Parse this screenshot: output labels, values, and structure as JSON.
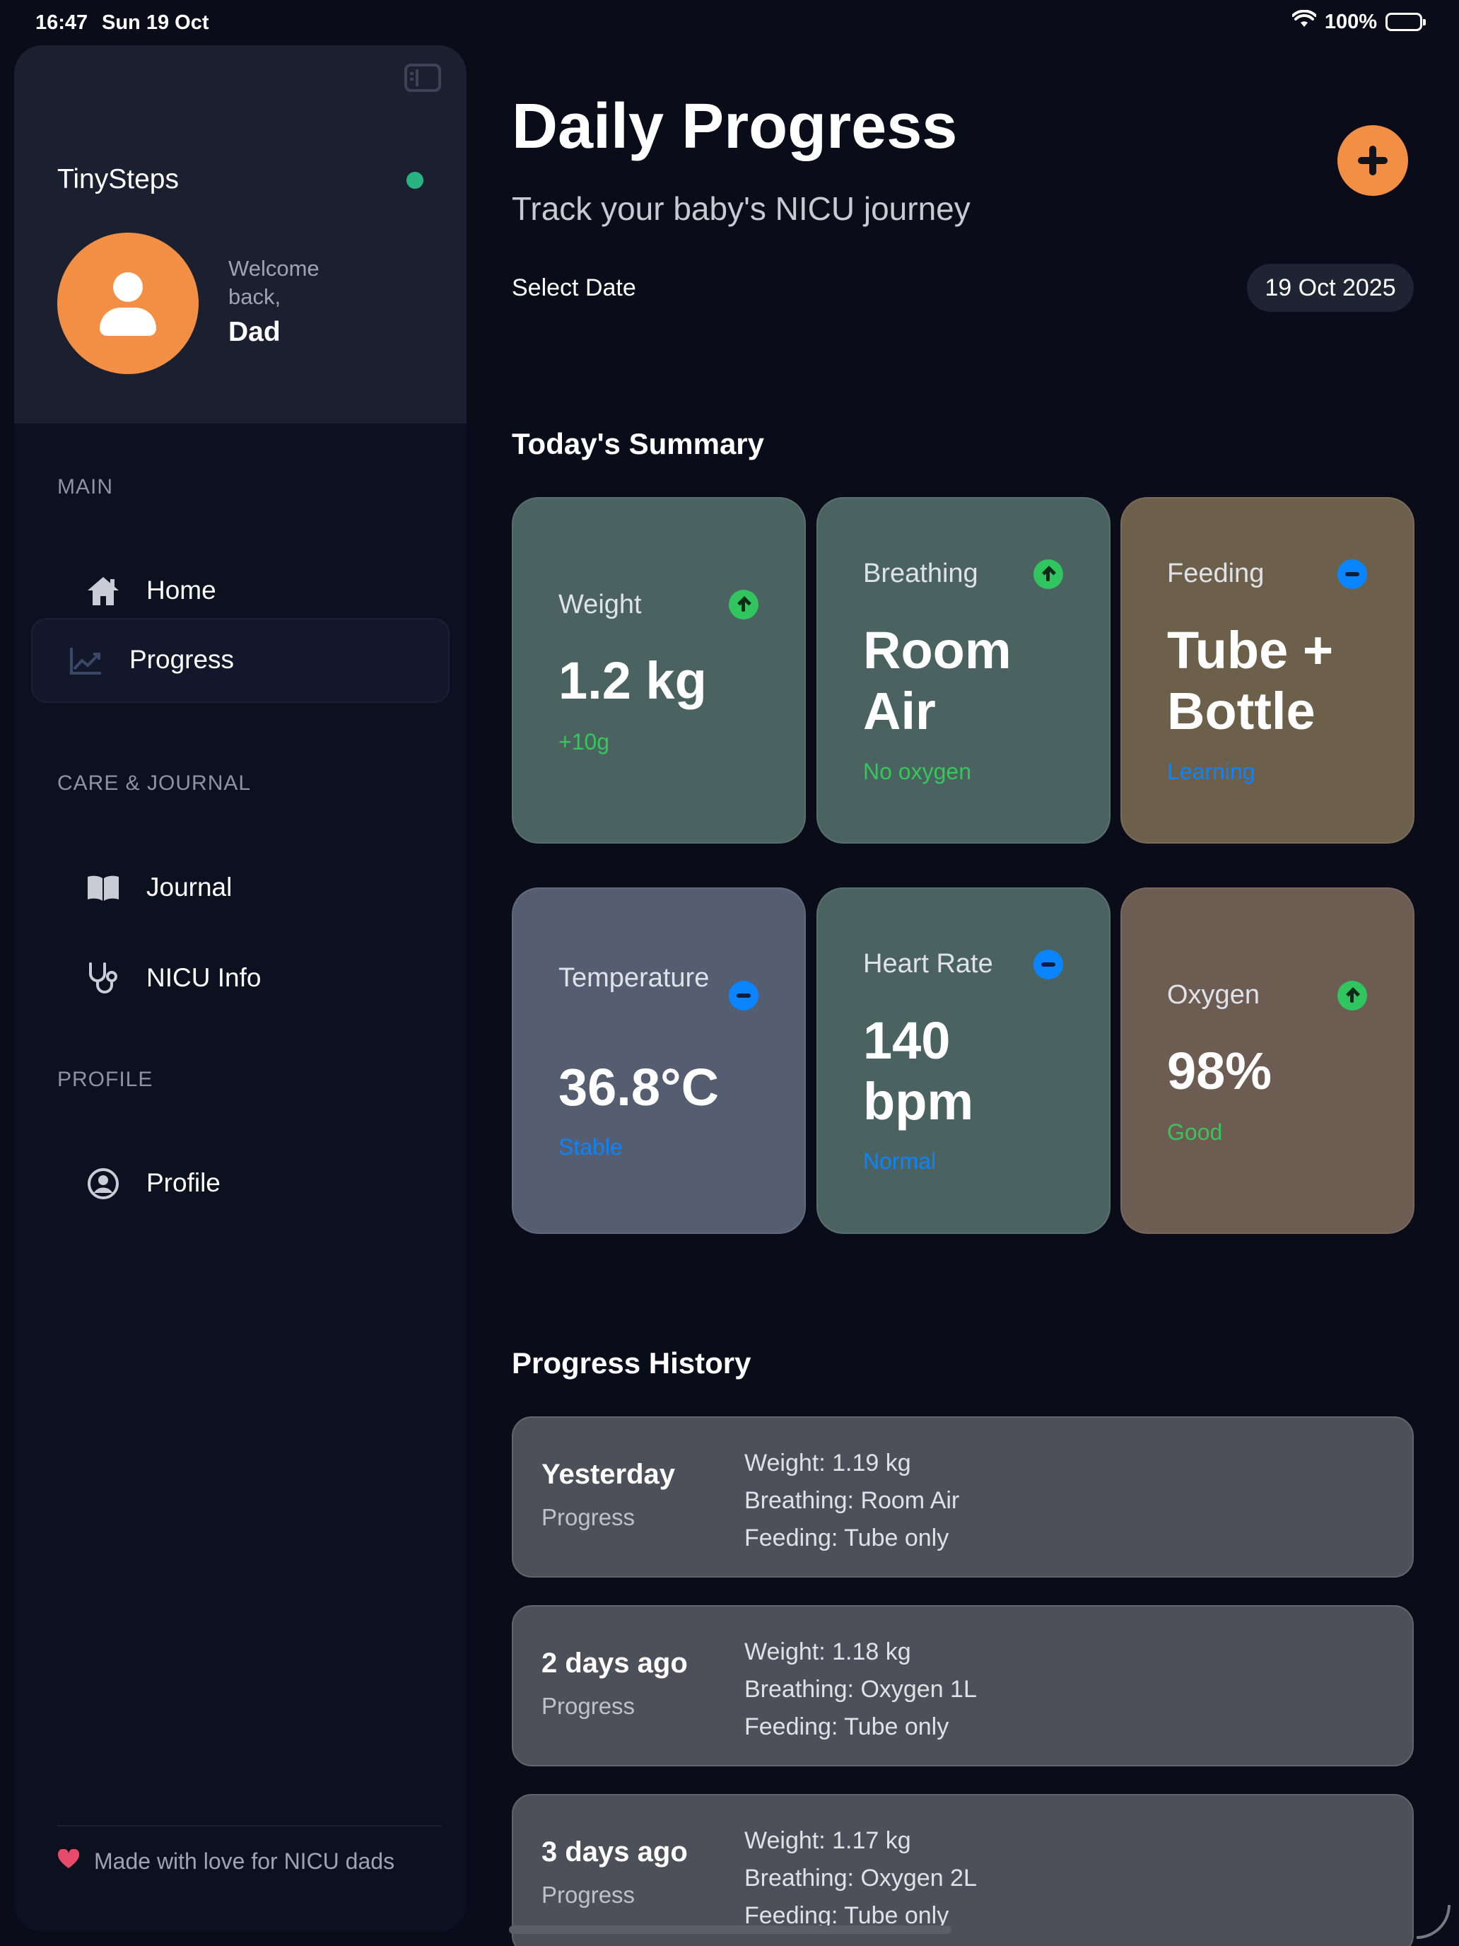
{
  "status_bar": {
    "time": "16:47",
    "date": "Sun 19 Oct",
    "battery": "100%"
  },
  "sidebar": {
    "app_name": "TinySteps",
    "welcome": "Welcome back,",
    "user_name": "Dad",
    "sections": {
      "main": "MAIN",
      "care": "CARE & JOURNAL",
      "profile": "PROFILE"
    },
    "items": [
      {
        "label": "Home",
        "icon": "house-icon"
      },
      {
        "label": "Progress",
        "icon": "chart-line-icon",
        "active": true
      },
      {
        "label": "Journal",
        "icon": "book-icon"
      },
      {
        "label": "NICU Info",
        "icon": "stethoscope-icon"
      },
      {
        "label": "Profile",
        "icon": "person-circle-icon"
      }
    ],
    "footer": "Made with love for NICU dads"
  },
  "main": {
    "title": "Daily Progress",
    "subtitle": "Track your baby's NICU journey",
    "select_date_label": "Select Date",
    "selected_date": "19 Oct 2025",
    "summary_title": "Today's Summary",
    "summary_cards": [
      {
        "title": "Weight",
        "value": "1.2 kg",
        "note": "+10g",
        "trend": "up",
        "color": "#4b6360"
      },
      {
        "title": "Breathing",
        "value": "Room Air",
        "note": "No oxygen",
        "trend": "up",
        "color": "#4b6360"
      },
      {
        "title": "Feeding",
        "value": "Tube + Bottle",
        "note": "Learning",
        "trend": "neutral",
        "color": "#6c604b"
      },
      {
        "title": "Temperature",
        "value": "36.8°C",
        "note": "Stable",
        "trend": "neutral",
        "color": "#545e70"
      },
      {
        "title": "Heart Rate",
        "value": "140 bpm",
        "note": "Normal",
        "trend": "neutral",
        "color": "#4b6360"
      },
      {
        "title": "Oxygen",
        "value": "98%",
        "note": "Good",
        "trend": "up",
        "color": "#6c5c52"
      }
    ],
    "history_title": "Progress History",
    "history": [
      {
        "day": "Yesterday",
        "sub": "Progress",
        "weight": "Weight: 1.19 kg",
        "breathing": "Breathing: Room Air",
        "feeding": "Feeding: Tube only"
      },
      {
        "day": "2 days ago",
        "sub": "Progress",
        "weight": "Weight: 1.18 kg",
        "breathing": "Breathing: Oxygen 1L",
        "feeding": "Feeding: Tube only"
      },
      {
        "day": "3 days ago",
        "sub": "Progress",
        "weight": "Weight: 1.17 kg",
        "breathing": "Breathing: Oxygen 2L",
        "feeding": "Feeding: Tube only"
      }
    ]
  },
  "colors": {
    "accent": "#f28f44",
    "online": "#29b382",
    "positive": "#35c759",
    "info": "#0a84ff"
  }
}
